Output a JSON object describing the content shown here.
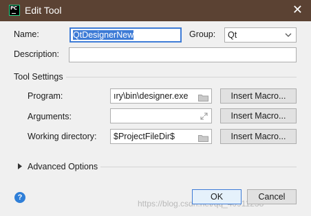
{
  "window": {
    "title": "Edit Tool",
    "close_glyph": "✕",
    "app_icon_text": "PC"
  },
  "form": {
    "name_label": "Name:",
    "name_value": "QtDesignerNew",
    "group_label": "Group:",
    "group_value": "Qt",
    "description_label": "Description:",
    "description_value": ""
  },
  "tool_settings": {
    "heading": "Tool Settings",
    "program_label": "Program:",
    "program_value": "ıry\\bin\\designer.exe",
    "arguments_label": "Arguments:",
    "arguments_value": "",
    "workdir_label": "Working directory:",
    "workdir_value": "$ProjectFileDir$",
    "insert_macro_label": "Insert Macro..."
  },
  "advanced": {
    "label": "Advanced Options"
  },
  "buttons": {
    "ok": "OK",
    "cancel": "Cancel",
    "help": "?"
  },
  "watermark": "https://blog.csdn.net/qq_40911238",
  "icons": {
    "folder": "folder-icon",
    "expand": "expand-icon",
    "dropdown": "chevron-down-icon",
    "caret": "caret-right-icon"
  },
  "colors": {
    "titlebar": "#5b4233",
    "accent": "#3d7bd6",
    "pycharm_green": "#21d789"
  }
}
